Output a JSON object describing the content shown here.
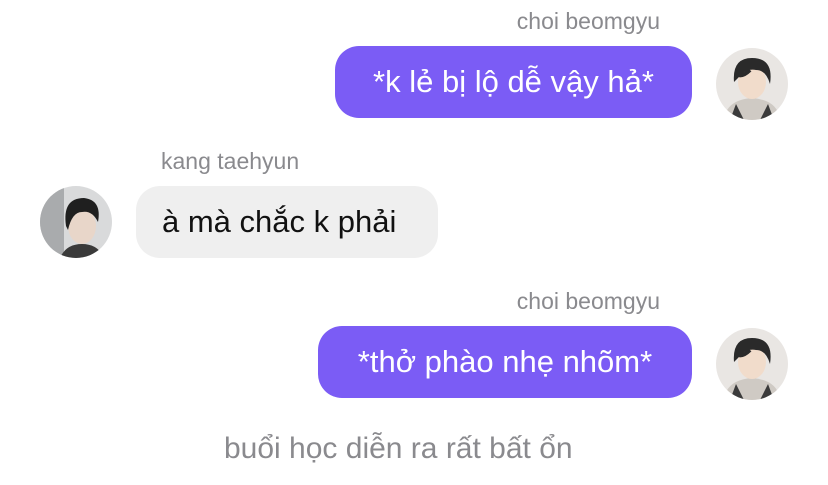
{
  "messages": [
    {
      "sender": "choi beomgyu",
      "text": "*k lẻ bị lộ dễ vậy hả*",
      "direction": "outgoing"
    },
    {
      "sender": "kang taehyun",
      "text": "à mà chắc k phải",
      "direction": "incoming"
    },
    {
      "sender": "choi beomgyu",
      "text": "*thở phào nhẹ nhõm*",
      "direction": "outgoing"
    }
  ],
  "narration": "buổi học diễn ra rất bất ổn",
  "colors": {
    "outgoing_bubble": "#7b5cf5",
    "incoming_bubble": "#efefef",
    "sender_text": "#8a8a8e"
  },
  "icons": {
    "beomgyu_avatar": "avatar-photo",
    "taehyun_avatar": "avatar-photo"
  }
}
